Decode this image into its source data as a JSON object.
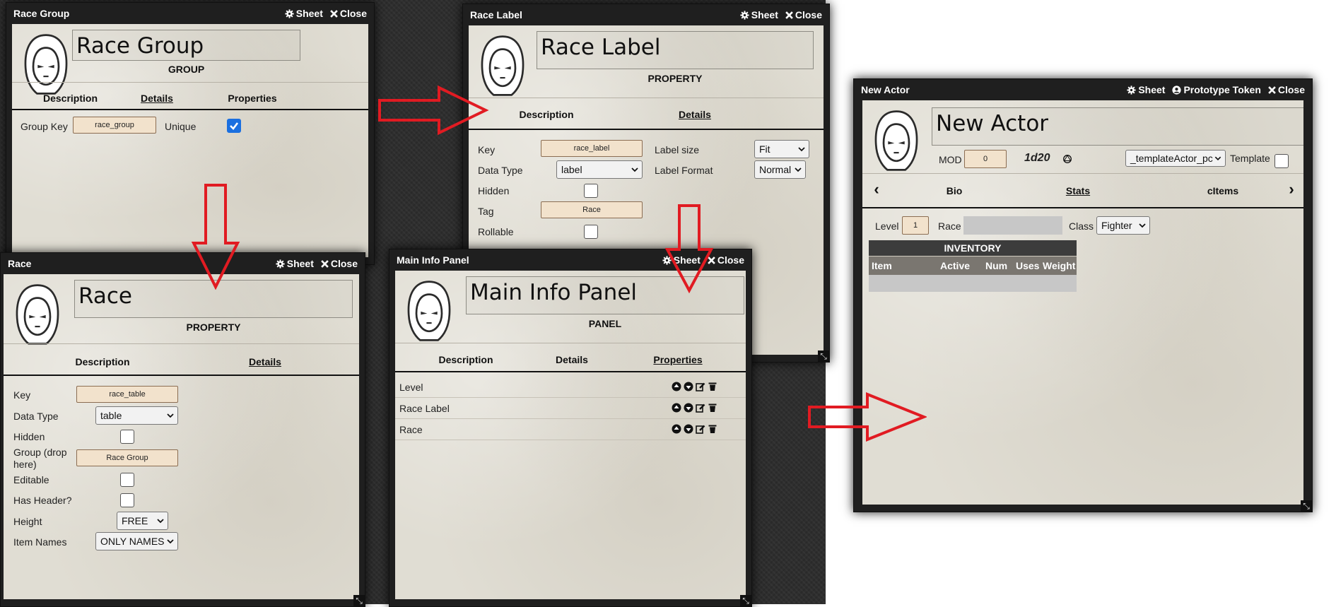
{
  "common": {
    "sheet": "Sheet",
    "close": "Close",
    "resize": "⤡"
  },
  "race_group": {
    "title": "Race Group",
    "name": "Race Group",
    "subtype": "GROUP",
    "tabs": [
      "Description",
      "Details",
      "Properties"
    ],
    "group_key_label": "Group Key",
    "group_key_value": "race_group",
    "unique_label": "Unique"
  },
  "race_label": {
    "title": "Race Label",
    "name": "Race Label",
    "subtype": "PROPERTY",
    "tabs": [
      "Description",
      "Details"
    ],
    "key_label": "Key",
    "key_value": "race_label",
    "data_type_label": "Data Type",
    "data_type_value": "label",
    "hidden_label": "Hidden",
    "tag_label": "Tag",
    "tag_value": "Race",
    "rollable_label": "Rollable",
    "label_size_label": "Label size",
    "label_size_value": "Fit",
    "label_format_label": "Label Format",
    "label_format_value": "Normal"
  },
  "race": {
    "title": "Race",
    "name": "Race",
    "subtype": "PROPERTY",
    "tabs": [
      "Description",
      "Details"
    ],
    "key_label": "Key",
    "key_value": "race_table",
    "data_type_label": "Data Type",
    "data_type_value": "table",
    "hidden_label": "Hidden",
    "group_label_1": "Group (drop",
    "group_label_2": "here)",
    "group_value": "Race Group",
    "editable_label": "Editable",
    "has_header_label": "Has Header?",
    "height_label": "Height",
    "height_value": "FREE",
    "item_names_label": "Item Names",
    "item_names_value": "ONLY NAMES"
  },
  "main_panel": {
    "title": "Main Info Panel",
    "name": "Main Info Panel",
    "subtype": "PANEL",
    "tabs": [
      "Description",
      "Details",
      "Properties"
    ],
    "rows": [
      "Level",
      "Race Label",
      "Race"
    ]
  },
  "actor": {
    "title": "New Actor",
    "prototype_token": "Prototype Token",
    "name": "New Actor",
    "mod_label": "MOD",
    "mod_value": "0",
    "dice": "1d20",
    "template_select": "_templateActor_pc",
    "template_label": "Template",
    "nav_prev": "‹",
    "nav_next": "›",
    "tabs": [
      "Bio",
      "Stats",
      "cItems"
    ],
    "level_label": "Level",
    "level_value": "1",
    "race_label": "Race",
    "class_label": "Class",
    "class_value": "Fighter",
    "inventory_title": "INVENTORY",
    "inventory_columns": [
      "Item",
      "Active",
      "Num",
      "Uses",
      "Weight"
    ]
  },
  "colors": {
    "arrow_red": "#e11b22",
    "checkbox_blue": "#1a6fe0",
    "input_bg": "#f2e2cc",
    "parchment": "#e0ddd3"
  }
}
